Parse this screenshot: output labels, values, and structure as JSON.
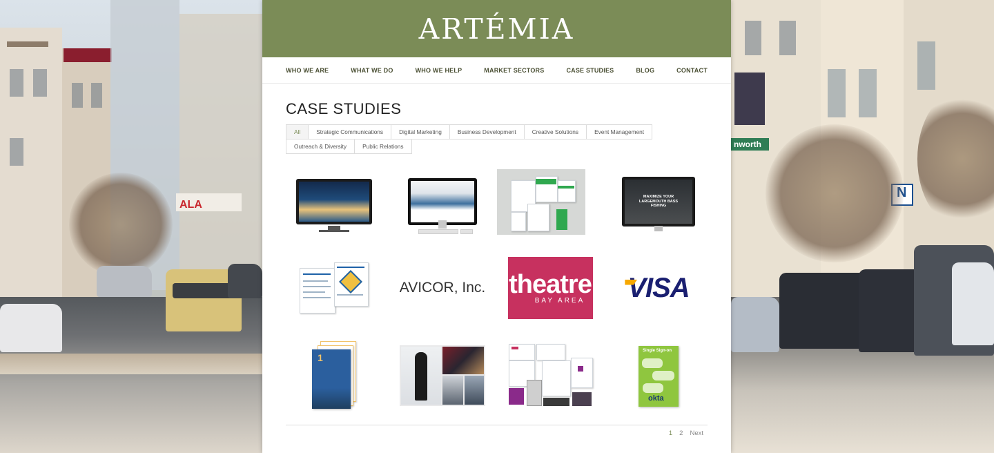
{
  "brand": {
    "logo_text": "ARTÉMIA",
    "header_color": "#7b8c57"
  },
  "nav": {
    "items": [
      {
        "label": "WHO WE ARE"
      },
      {
        "label": "WHAT WE DO"
      },
      {
        "label": "WHO WE HELP"
      },
      {
        "label": "MARKET SECTORS"
      },
      {
        "label": "CASE STUDIES"
      },
      {
        "label": "BLOG"
      },
      {
        "label": "CONTACT"
      }
    ]
  },
  "main": {
    "title": "CASE STUDIES",
    "filters": [
      {
        "label": "All",
        "active": true
      },
      {
        "label": "Strategic Communications"
      },
      {
        "label": "Digital Marketing"
      },
      {
        "label": "Business Development"
      },
      {
        "label": "Creative Solutions"
      },
      {
        "label": "Event Management"
      },
      {
        "label": "Outreach & Diversity"
      },
      {
        "label": "Public Relations"
      }
    ],
    "tiles_text": {
      "monitor_banner": "MAXIMIZE YOUR LARGEMOUTH BASS FISHING",
      "avicor": "AVICOR, Inc.",
      "theatre_main": "theatre",
      "theatre_sub": "BAY AREA",
      "visa": "VISA",
      "report_number": "1",
      "okta_title": "Single Sign-on",
      "okta_logo": "okta"
    },
    "pagination": {
      "current": "1",
      "page2": "2",
      "next": "Next"
    }
  },
  "colors": {
    "accent": "#7b8c57",
    "theatre": "#c7315f",
    "visa_blue": "#1a1f71",
    "visa_gold": "#f7a800",
    "okta_green": "#8fc63f"
  }
}
